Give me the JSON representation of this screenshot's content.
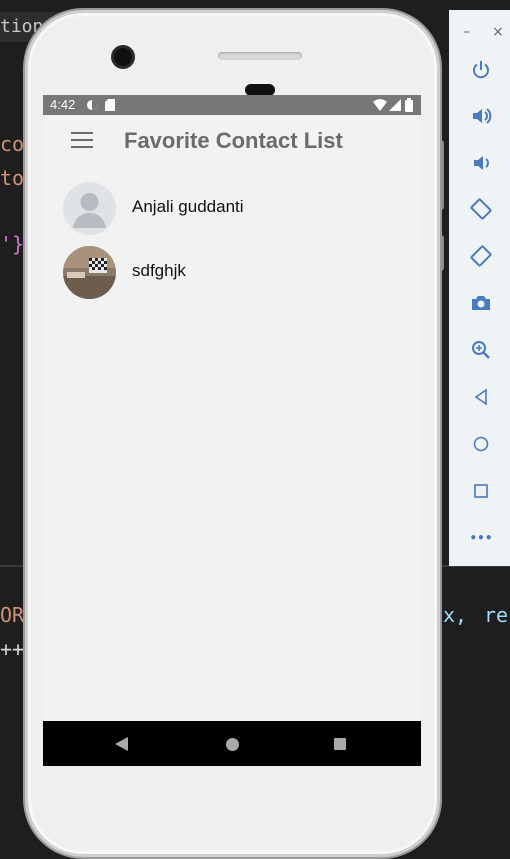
{
  "editor": {
    "tab_label": "tion(",
    "code_fragments": [
      "cor",
      "tor",
      "'}",
      "ORI",
      "++",
      "x,",
      "re"
    ]
  },
  "toolbar": {
    "minimize_label": "–",
    "close_label": "×",
    "buttons": [
      "power",
      "volume-up",
      "volume-down",
      "rotate-left",
      "rotate-right",
      "screenshot",
      "zoom",
      "back",
      "home",
      "overview",
      "more"
    ],
    "more_label": "•••"
  },
  "phone": {
    "status_bar": {
      "time": "4:42"
    },
    "app_bar": {
      "title": "Favorite Contact List"
    },
    "contacts": [
      {
        "name": "Anjali guddanti",
        "avatar": "default-person-avatar"
      },
      {
        "name": "sdfghjk",
        "avatar": "room-photo-avatar"
      }
    ]
  },
  "colors": {
    "screen_bg": "#f2f2f2",
    "status_bar": "#777777",
    "title_text": "#6b6b6b",
    "nav_bar": "#000000",
    "editor_bg": "#1e1e1e",
    "toolbar_bg": "#eff3f6",
    "toolbar_icon": "#4a7bbf"
  }
}
